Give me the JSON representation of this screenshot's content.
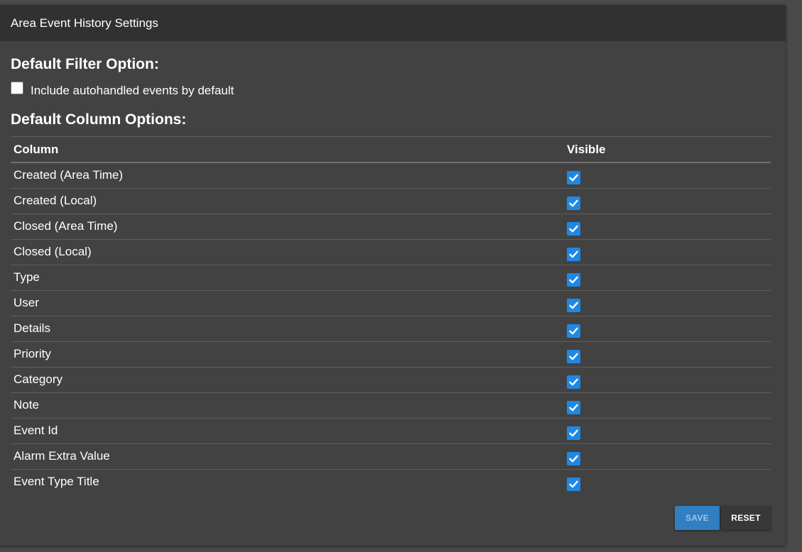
{
  "header": {
    "title": "Area Event History Settings"
  },
  "filter": {
    "title": "Default Filter Option:",
    "autohandled": {
      "label": "Include autohandled events by default",
      "checked": false
    }
  },
  "columns": {
    "title": "Default Column Options:",
    "header_column": "Column",
    "header_visible": "Visible",
    "rows": [
      {
        "name": "Created (Area Time)",
        "visible": true
      },
      {
        "name": "Created (Local)",
        "visible": true
      },
      {
        "name": "Closed (Area Time)",
        "visible": true
      },
      {
        "name": "Closed (Local)",
        "visible": true
      },
      {
        "name": "Type",
        "visible": true
      },
      {
        "name": "User",
        "visible": true
      },
      {
        "name": "Details",
        "visible": true
      },
      {
        "name": "Priority",
        "visible": true
      },
      {
        "name": "Category",
        "visible": true
      },
      {
        "name": "Note",
        "visible": true
      },
      {
        "name": "Event Id",
        "visible": true
      },
      {
        "name": "Alarm Extra Value",
        "visible": true
      },
      {
        "name": "Event Type Title",
        "visible": true
      }
    ]
  },
  "buttons": {
    "save": "SAVE",
    "reset": "RESET"
  },
  "colors": {
    "accent": "#1e88e5",
    "save_bg": "#2f7fc1",
    "header_bg": "#313131",
    "panel_bg": "#424242"
  },
  "icons": {
    "checked": "check-icon"
  }
}
